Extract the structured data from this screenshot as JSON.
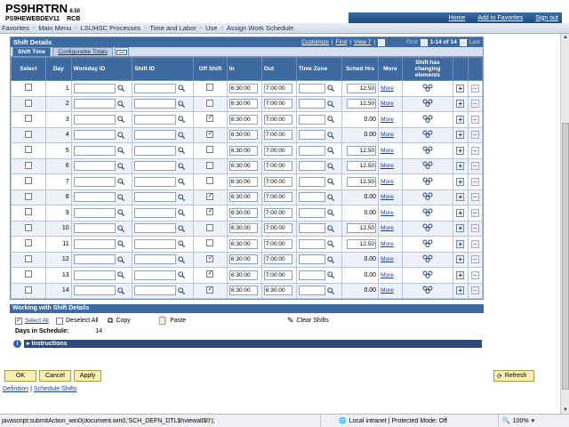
{
  "header": {
    "app_name": "PS9HRTRN",
    "version": "8.50",
    "database": "PS9HEWEBDEV11",
    "user": "RCB",
    "links": [
      "Home",
      "Add to Favorites",
      "Sign out"
    ]
  },
  "breadcrumbs": [
    "Favorites",
    "Main Menu",
    "LSUHSC Processes",
    "Time and Labor",
    "Use",
    "Assign Work Schedule"
  ],
  "grid": {
    "title": "Shift Details",
    "customize": "Customize",
    "find": "Find",
    "view": "View 7",
    "first": "First",
    "range": "1-14 of 14",
    "last": "Last",
    "tabs": [
      "Shift Time",
      "Configurable Totals"
    ],
    "columns": [
      "Select",
      "Day",
      "Workday ID",
      "Shift ID",
      "Off Shift",
      "In",
      "Out",
      "Time Zone",
      "Sched Hrs",
      "More",
      "Shift has changing elements"
    ],
    "more_label": "More",
    "rows": [
      {
        "day": "1",
        "off": false,
        "in": "6:30:00",
        "out": "7:00:00",
        "hrs": "12.50",
        "hrs_input": true
      },
      {
        "day": "2",
        "off": false,
        "in": "6:30:00",
        "out": "7:00:00",
        "hrs": "12.50",
        "hrs_input": true
      },
      {
        "day": "3",
        "off": true,
        "in": "6:30:00",
        "out": "7:00:00",
        "hrs": "0.00",
        "hrs_input": false
      },
      {
        "day": "4",
        "off": true,
        "in": "6:30:00",
        "out": "7:00:00",
        "hrs": "0.00",
        "hrs_input": false
      },
      {
        "day": "5",
        "off": false,
        "in": "6:30:00",
        "out": "7:00:00",
        "hrs": "12.50",
        "hrs_input": true
      },
      {
        "day": "6",
        "off": false,
        "in": "6:30:00",
        "out": "7:00:00",
        "hrs": "12.50",
        "hrs_input": true
      },
      {
        "day": "7",
        "off": false,
        "in": "6:30:00",
        "out": "7:00:00",
        "hrs": "12.50",
        "hrs_input": true
      },
      {
        "day": "8",
        "off": true,
        "in": "6:30:00",
        "out": "7:00:00",
        "hrs": "0.00",
        "hrs_input": false
      },
      {
        "day": "9",
        "off": true,
        "in": "6:30:00",
        "out": "7:00:00",
        "hrs": "0.00",
        "hrs_input": false
      },
      {
        "day": "10",
        "off": false,
        "in": "6:30:00",
        "out": "7:00:00",
        "hrs": "12.50",
        "hrs_input": true
      },
      {
        "day": "11",
        "off": false,
        "in": "6:30:00",
        "out": "7:00:00",
        "hrs": "12.50",
        "hrs_input": true
      },
      {
        "day": "12",
        "off": true,
        "in": "6:30:00",
        "out": "7:00:00",
        "hrs": "0.00",
        "hrs_input": false
      },
      {
        "day": "13",
        "off": true,
        "in": "6:30:00",
        "out": "7:00:00",
        "hrs": "0.00",
        "hrs_input": false
      },
      {
        "day": "14",
        "off": true,
        "in": "6:30:00",
        "out": "6:30:00",
        "hrs": "0.00",
        "hrs_input": false
      }
    ]
  },
  "working": {
    "title": "Working with Shift Details",
    "select_all": "Select All",
    "deselect_all": "Deselect All",
    "copy": "Copy",
    "paste": "Paste",
    "clear": "Clear Shifts",
    "days_label": "Days in Schedule:",
    "days_value": "14",
    "instructions": "Instructions"
  },
  "buttons": {
    "ok": "OK",
    "cancel": "Cancel",
    "apply": "Apply",
    "refresh": "Refresh"
  },
  "footer": {
    "definition": "Definition",
    "sep": " | ",
    "schedule_shifts": "Schedule Shifts"
  },
  "status": {
    "url": "javascript:submitAction_win0(document.win0,'SCH_DEFN_DTL$hviewall$0');",
    "zone": "Local intranet | Protected Mode: Off",
    "zoom": "100%"
  }
}
